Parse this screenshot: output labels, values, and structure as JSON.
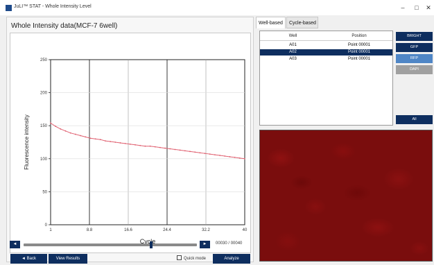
{
  "window": {
    "title": "JuLI™ STAT - Whole Intensity Level",
    "icon_label": "JuLI",
    "minimize": "–",
    "maximize": "□",
    "close": "✕"
  },
  "panel": {
    "title": "Whole Intensity data(MCF-7 6well)"
  },
  "chart_data": {
    "type": "line",
    "xlabel": "Cycle",
    "ylabel": "Fluorescence intensity",
    "xlim": [
      1,
      40
    ],
    "ylim": [
      0,
      250
    ],
    "x_ticks": [
      "1",
      "8.8",
      "16.6",
      "24.4",
      "32.2",
      "40"
    ],
    "y_ticks": [
      "0",
      "50",
      "100",
      "150",
      "200",
      "250"
    ],
    "grid": "vertical major lines",
    "series": [
      {
        "color": "#e06070",
        "x": [
          1,
          2,
          3,
          4,
          5,
          6,
          7,
          8,
          9,
          10,
          11,
          12,
          13,
          14,
          15,
          16,
          17,
          18,
          19,
          20,
          21,
          22,
          23,
          24,
          25,
          26,
          27,
          28,
          29,
          30,
          31,
          32,
          33,
          34,
          35,
          36,
          37,
          38,
          39,
          40
        ],
        "y": [
          154,
          149,
          145,
          142,
          139,
          137,
          135,
          133,
          131,
          130,
          129,
          127,
          126,
          125,
          124,
          123,
          122,
          121,
          120,
          119,
          119,
          118,
          117,
          116,
          115,
          114,
          113,
          112,
          111,
          110,
          109,
          108,
          107,
          106,
          105,
          104,
          103,
          102,
          101,
          100
        ]
      }
    ]
  },
  "nav": {
    "prev": "◄",
    "next": "►",
    "current": "00030",
    "separator": "/",
    "total": "00040",
    "progress": 0.74
  },
  "buttons": {
    "back": "◄ Back",
    "view_results": "View Results",
    "quick_mode": "Quick mode",
    "analyze": "Analyze"
  },
  "tabs": [
    {
      "label": "Well-based",
      "active": true
    },
    {
      "label": "Cycle-based",
      "active": false
    }
  ],
  "table": {
    "headers": [
      "Well",
      "Position"
    ],
    "rows": [
      {
        "well": "A01",
        "position": "Point 00001",
        "selected": false
      },
      {
        "well": "A02",
        "position": "Point 00001",
        "selected": true
      },
      {
        "well": "A03",
        "position": "Point 00001",
        "selected": false
      }
    ]
  },
  "channels": [
    {
      "label": "BRIGHT",
      "color": "#0e2e5f"
    },
    {
      "label": "GFP",
      "color": "#0e2e5f"
    },
    {
      "label": "RFP",
      "color": "#4f86c6"
    },
    {
      "label": "DAPI",
      "color": "#a0a0a0"
    }
  ],
  "all_button": "All",
  "colors": {
    "accent": "#0e2e5f",
    "line": "#e06070",
    "image": "#7a0d0d"
  }
}
